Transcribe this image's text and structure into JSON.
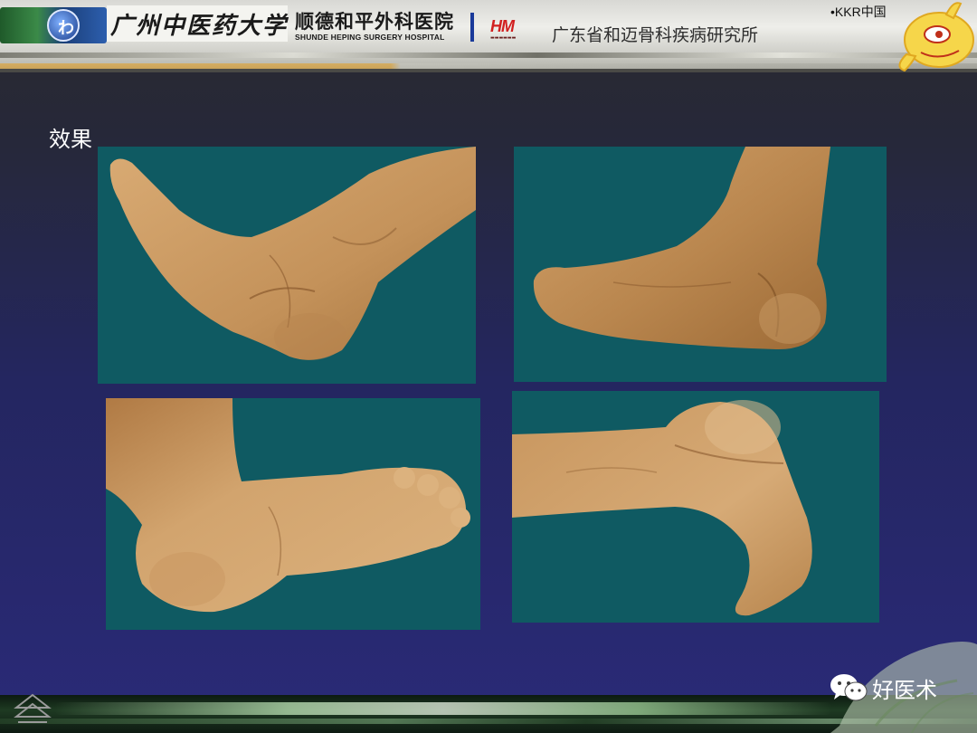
{
  "header": {
    "university": "广州中医药大学",
    "hospital_cn": "顺德和平外科医院",
    "hospital_en": "SHUNDE HEPING SURGERY HOSPITAL",
    "hm_logo": "HM",
    "institute": "广东省和迈骨科疾病研究所",
    "kkr": "•KKR中国"
  },
  "slide": {
    "title": "效果",
    "photos": [
      {
        "name": "foot-medial-view",
        "background": "#0f5a62"
      },
      {
        "name": "foot-lateral-view",
        "background": "#0f5a62"
      },
      {
        "name": "foot-plantar-view",
        "background": "#0f5a62"
      },
      {
        "name": "heel-posterior-view",
        "background": "#0f5a62"
      }
    ]
  },
  "footer": {
    "brand": "好医术",
    "brand_icon": "wechat-icon",
    "nav_icon": "chevron-up-double-icon"
  },
  "colors": {
    "slide_background": "#24265e",
    "photo_background": "#0f5a62",
    "skin": "#c9985e",
    "title_text": "#ffffff"
  }
}
